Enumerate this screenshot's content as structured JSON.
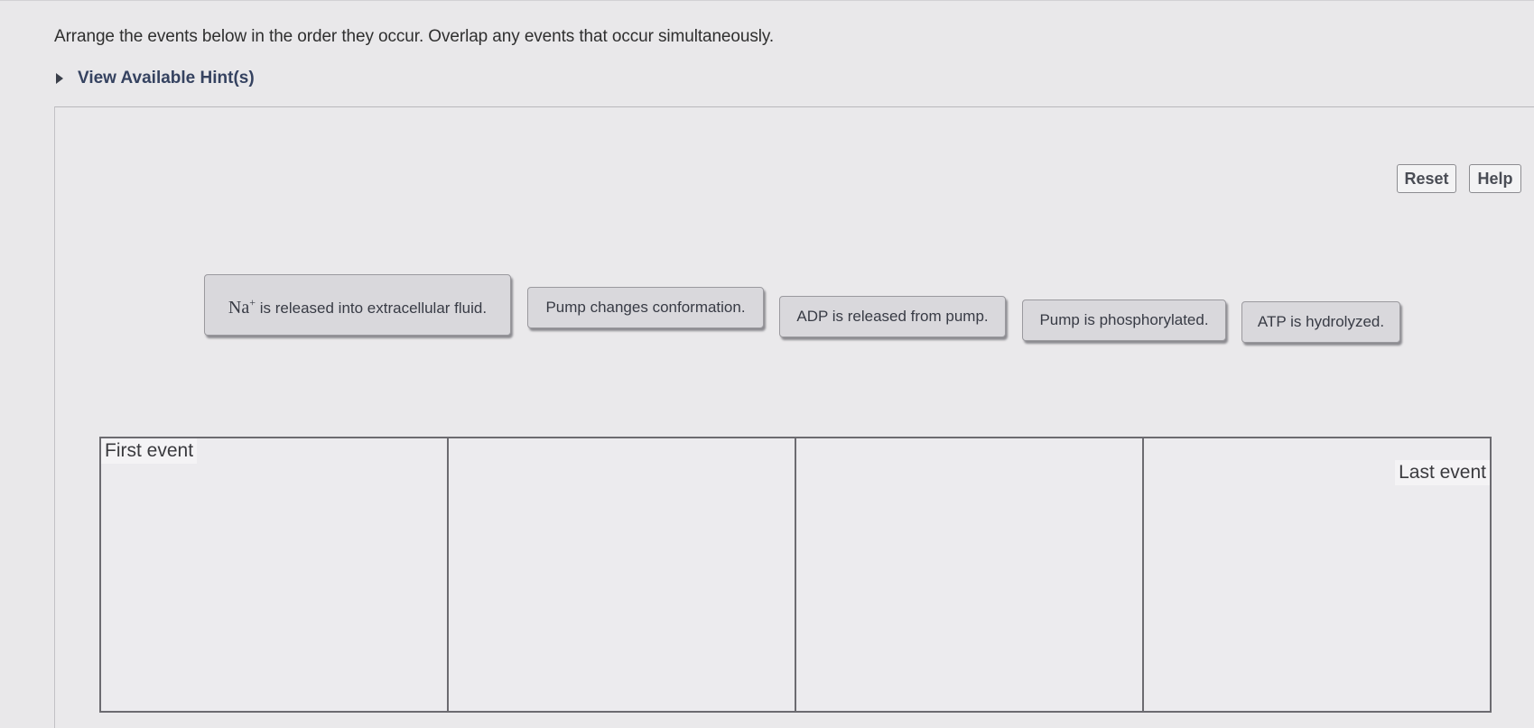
{
  "question": "Arrange the events below in the order they occur. Overlap any events that occur simultaneously.",
  "hint": {
    "label": "View Available Hint(s)"
  },
  "toolbar": {
    "reset_label": "Reset",
    "help_label": "Help"
  },
  "events": [
    {
      "symbol": "Na",
      "superscript": "+",
      "text": " is released into extracellular fluid."
    },
    {
      "text": "Pump changes conformation."
    },
    {
      "text": "ADP is released from pump."
    },
    {
      "text": "Pump is phosphorylated."
    },
    {
      "text": "ATP is hydrolyzed."
    }
  ],
  "grid": {
    "first_label": "First event",
    "last_label": "Last event"
  }
}
